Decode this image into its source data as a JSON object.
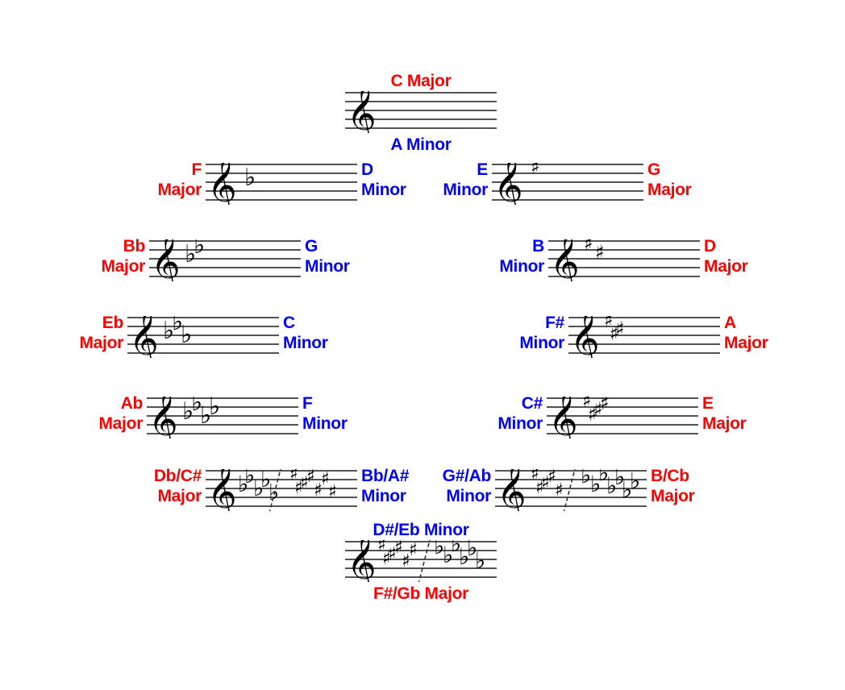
{
  "diagram": {
    "title": "Circle of Fifths key signatures",
    "colors": {
      "major": "#ff0000",
      "minor": "#0000ff",
      "staff": "#000000",
      "background": "#ffffff"
    }
  },
  "keys": [
    {
      "id": "c-major",
      "major_l1": "C Major",
      "major_l2": "",
      "minor_l1": "A Minor",
      "minor_l2": "",
      "accidental_type": "none",
      "accidental_count": 0,
      "major_pos": "top",
      "minor_pos": "bottom"
    },
    {
      "id": "f-major",
      "major_l1": "F",
      "major_l2": "Major",
      "minor_l1": "D",
      "minor_l2": "Minor",
      "accidental_type": "flat",
      "accidental_count": 1,
      "major_pos": "left",
      "minor_pos": "right"
    },
    {
      "id": "g-major",
      "major_l1": "G",
      "major_l2": "Major",
      "minor_l1": "E",
      "minor_l2": "Minor",
      "accidental_type": "sharp",
      "accidental_count": 1,
      "major_pos": "right",
      "minor_pos": "left"
    },
    {
      "id": "bb-major",
      "major_l1": "Bb",
      "major_l2": "Major",
      "minor_l1": "G",
      "minor_l2": "Minor",
      "accidental_type": "flat",
      "accidental_count": 2,
      "major_pos": "left",
      "minor_pos": "right"
    },
    {
      "id": "d-major",
      "major_l1": "D",
      "major_l2": "Major",
      "minor_l1": "B",
      "minor_l2": "Minor",
      "accidental_type": "sharp",
      "accidental_count": 2,
      "major_pos": "right",
      "minor_pos": "left"
    },
    {
      "id": "eb-major",
      "major_l1": "Eb",
      "major_l2": "Major",
      "minor_l1": "C",
      "minor_l2": "Minor",
      "accidental_type": "flat",
      "accidental_count": 3,
      "major_pos": "left",
      "minor_pos": "right"
    },
    {
      "id": "a-major",
      "major_l1": "A",
      "major_l2": "Major",
      "minor_l1": "F#",
      "minor_l2": "Minor",
      "accidental_type": "sharp",
      "accidental_count": 3,
      "major_pos": "right",
      "minor_pos": "left"
    },
    {
      "id": "ab-major",
      "major_l1": "Ab",
      "major_l2": "Major",
      "minor_l1": "F",
      "minor_l2": "Minor",
      "accidental_type": "flat",
      "accidental_count": 4,
      "major_pos": "left",
      "minor_pos": "right"
    },
    {
      "id": "e-major",
      "major_l1": "E",
      "major_l2": "Major",
      "minor_l1": "C#",
      "minor_l2": "Minor",
      "accidental_type": "sharp",
      "accidental_count": 4,
      "major_pos": "right",
      "minor_pos": "left"
    },
    {
      "id": "db-cs-major",
      "major_l1": "Db/C#",
      "major_l2": "Major",
      "minor_l1": "Bb/A#",
      "minor_l2": "Minor",
      "accidental_type": "both-flat-first",
      "accidental_count": 5,
      "major_pos": "left",
      "minor_pos": "right"
    },
    {
      "id": "b-cb-major",
      "major_l1": "B/Cb",
      "major_l2": "Major",
      "minor_l1": "G#/Ab",
      "minor_l2": "Minor",
      "accidental_type": "both-sharp-first",
      "accidental_count": 5,
      "major_pos": "right",
      "minor_pos": "left"
    },
    {
      "id": "fs-gb-major",
      "major_l1": "F#/Gb Major",
      "major_l2": "",
      "minor_l1": "D#/Eb Minor",
      "minor_l2": "",
      "accidental_type": "both-sharp-first",
      "accidental_count": 6,
      "major_pos": "bottom",
      "minor_pos": "top"
    }
  ]
}
